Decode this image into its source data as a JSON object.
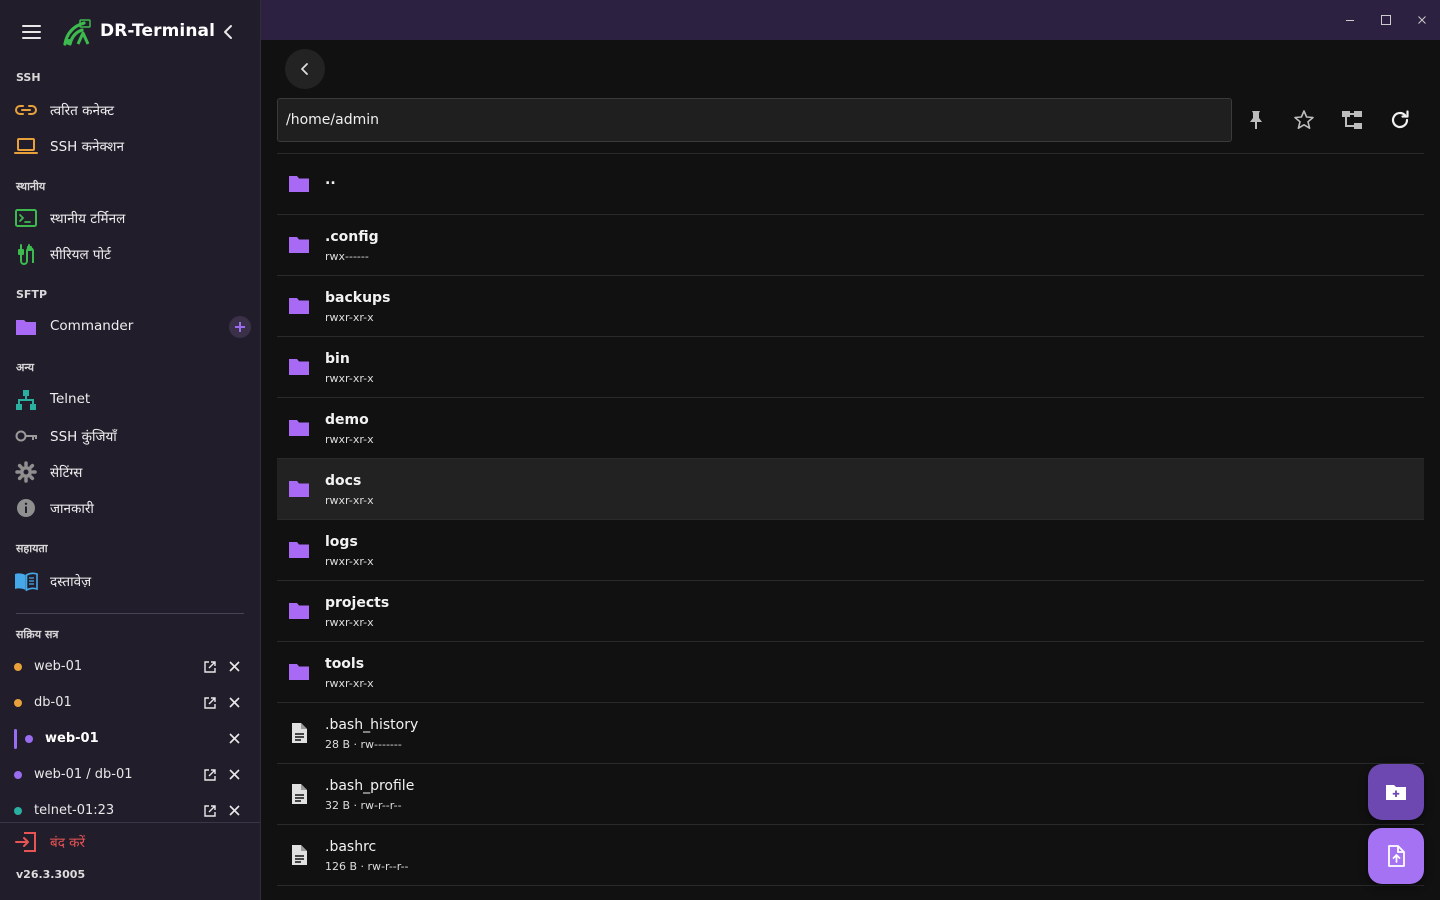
{
  "app": {
    "title": "DR-Terminal",
    "version": "v26.3.3005"
  },
  "colors": {
    "accent": "#9a6cf0",
    "folder": "#a86af5",
    "titlebar": "#2c2140",
    "sidebar": "#221d2b",
    "danger": "#e85454",
    "orange": "#e8a13a",
    "green": "#3dba4e",
    "teal": "#2ab0a0",
    "blue": "#45a8e8"
  },
  "sidebar": {
    "sections": {
      "ssh": "SSH",
      "local": "स्थानीय",
      "sftp": "SFTP",
      "other": "अन्य",
      "help": "सहायता",
      "sessions": "सक्रिय सत्र"
    },
    "items": [
      {
        "label": "त्वरित कनेक्ट",
        "icon": "link-icon"
      },
      {
        "label": "SSH कनेक्शन",
        "icon": "laptop-icon"
      },
      {
        "label": "स्थानीय टर्मिनल",
        "icon": "terminal-icon"
      },
      {
        "label": "सीरियल पोर्ट",
        "icon": "serial-port-icon"
      },
      {
        "label": "Commander",
        "icon": "folder-icon"
      },
      {
        "label": "Telnet",
        "icon": "network-icon"
      },
      {
        "label": "SSH कुंजियाँ",
        "icon": "key-icon"
      },
      {
        "label": "सेटिंग्स",
        "icon": "gear-icon"
      },
      {
        "label": "जानकारी",
        "icon": "info-icon"
      },
      {
        "label": "दस्तावेज़",
        "icon": "book-icon"
      }
    ],
    "sessions": [
      {
        "label": "web-01",
        "color": "#e8a13a"
      },
      {
        "label": "db-01",
        "color": "#e8a13a"
      },
      {
        "label": "web-01",
        "color": "#9a6cf0",
        "active": true
      },
      {
        "label": "web-01 / db-01",
        "color": "#9a6cf0"
      },
      {
        "label": "telnet-01:23",
        "color": "#2ab0a0"
      }
    ],
    "quit_label": "बंद करें"
  },
  "browser": {
    "path": "/home/admin",
    "entries": [
      {
        "name": "..",
        "meta": "",
        "type": "folder"
      },
      {
        "name": ".config",
        "meta": "rwx------",
        "type": "folder"
      },
      {
        "name": "backups",
        "meta": "rwxr-xr-x",
        "type": "folder"
      },
      {
        "name": "bin",
        "meta": "rwxr-xr-x",
        "type": "folder"
      },
      {
        "name": "demo",
        "meta": "rwxr-xr-x",
        "type": "folder"
      },
      {
        "name": "docs",
        "meta": "rwxr-xr-x",
        "type": "folder",
        "selected": true
      },
      {
        "name": "logs",
        "meta": "rwxr-xr-x",
        "type": "folder"
      },
      {
        "name": "projects",
        "meta": "rwxr-xr-x",
        "type": "folder"
      },
      {
        "name": "tools",
        "meta": "rwxr-xr-x",
        "type": "folder"
      },
      {
        "name": ".bash_history",
        "meta": "28 B · rw-------",
        "type": "file"
      },
      {
        "name": ".bash_profile",
        "meta": "32 B · rw-r--r--",
        "type": "file"
      },
      {
        "name": ".bashrc",
        "meta": "126 B · rw-r--r--",
        "type": "file"
      }
    ]
  }
}
